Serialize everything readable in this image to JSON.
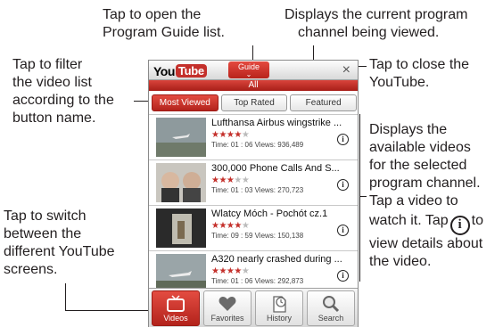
{
  "callouts": {
    "guide": [
      "Tap to open the",
      "Program Guide list."
    ],
    "channel": [
      "Displays the current program",
      "channel being viewed."
    ],
    "filter": [
      "Tap to filter",
      "the video list",
      "according to the",
      "button name."
    ],
    "close": [
      "Tap to close the",
      "YouTube."
    ],
    "videos": [
      "Displays the",
      "available videos",
      "for the selected",
      "program channel.",
      "Tap a video to"
    ],
    "videos_tail": {
      "before": "watch it. Tap",
      "after": "to",
      "last1": "view details about",
      "last2": "the video."
    },
    "switch": [
      "Tap to switch",
      "between the",
      "different YouTube",
      "screens."
    ]
  },
  "app": {
    "logo_you": "You",
    "logo_tube": "Tube",
    "guide_label": "Guide",
    "close_glyph": "×",
    "channel": "All"
  },
  "filters": [
    {
      "label": "Most Viewed",
      "active": true
    },
    {
      "label": "Top Rated",
      "active": false
    },
    {
      "label": "Featured",
      "active": false
    }
  ],
  "videos": [
    {
      "title": "Lufthansa Airbus wingstrike ...",
      "rating": 4,
      "time": "01:06",
      "views": "936,489",
      "meta": "Time:  01 : 06   Views: 936,489"
    },
    {
      "title": "300,000 Phone Calls And S...",
      "rating": 3,
      "time": "01:03",
      "views": "270,723",
      "meta": "Time:  01 : 03   Views: 270,723"
    },
    {
      "title": "Wlatcy Móch -  Pochót cz.1",
      "rating": 4,
      "time": "09:59",
      "views": "150,138",
      "meta": "Time:  09 : 59   Views: 150,138"
    },
    {
      "title": "A320 nearly crashed during ...",
      "rating": 4,
      "time": "01:06",
      "views": "292,873",
      "meta": "Time:  01 : 06   Views: 292,873"
    }
  ],
  "nav": [
    {
      "label": "Videos",
      "icon": "tv-icon",
      "active": true
    },
    {
      "label": "Favorites",
      "icon": "heart-icon",
      "active": false
    },
    {
      "label": "History",
      "icon": "clock-document-icon",
      "active": false
    },
    {
      "label": "Search",
      "icon": "magnifier-icon",
      "active": false
    }
  ],
  "colors": {
    "accent": "#c4302b",
    "text": "#231f20"
  }
}
